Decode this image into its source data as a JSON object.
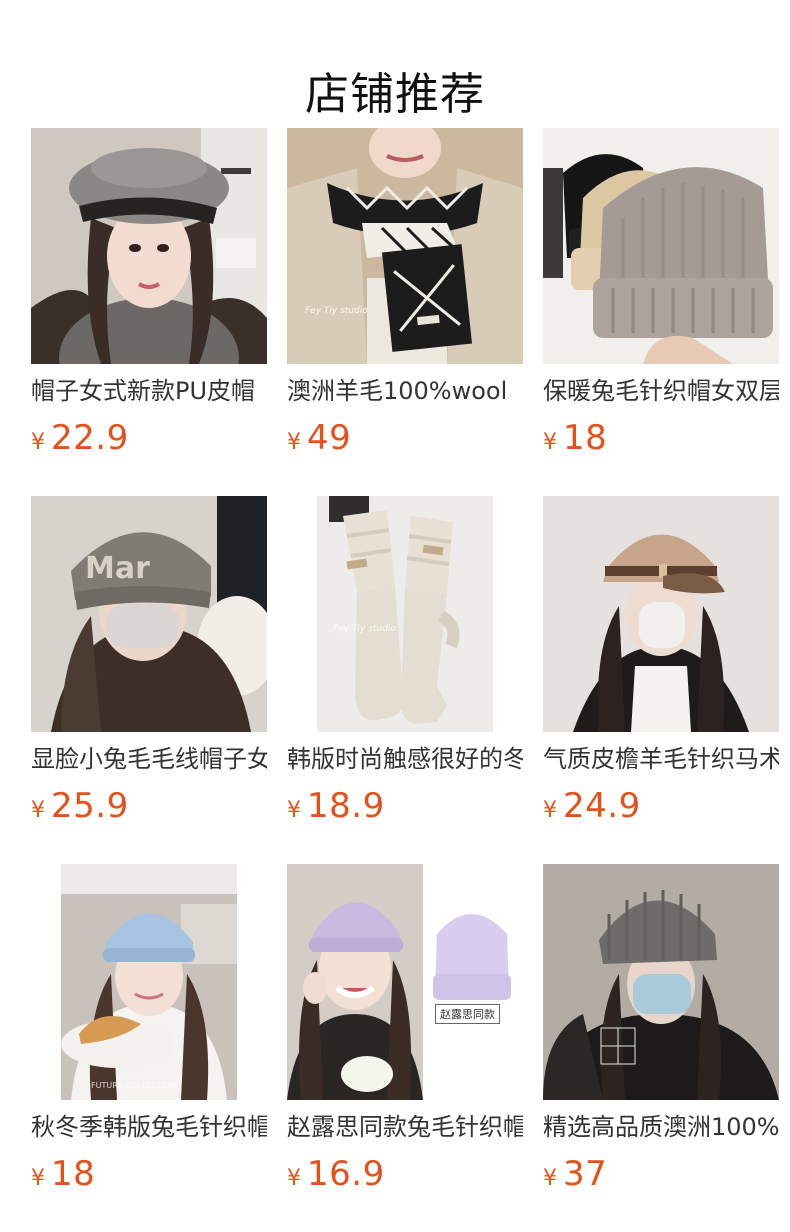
{
  "section": {
    "title": "店铺推荐"
  },
  "currency_symbol": "¥",
  "products": [
    {
      "title": "帽子女式新款PU皮帽",
      "price": "22.9",
      "image": "woman-grey-beret-photo"
    },
    {
      "title": "澳洲羊毛100%wool",
      "price": "49",
      "image": "black-white-argyle-scarf-photo"
    },
    {
      "title": "保暖兔毛针织帽女双层",
      "price": "18",
      "image": "stacked-knit-beanies-photo"
    },
    {
      "title": "显脸小兔毛毛线帽子女",
      "price": "25.9",
      "image": "woman-grey-letter-beanie-mask-photo"
    },
    {
      "title": "韩版时尚触感很好的冬",
      "price": "18.9",
      "image": "cream-knit-gloves-photo"
    },
    {
      "title": "气质皮檐羊毛针织马术",
      "price": "24.9",
      "image": "woman-tan-equestrian-hat-photo"
    },
    {
      "title": "秋冬季韩版兔毛针织帽",
      "price": "18",
      "image": "woman-light-blue-beanie-croissant-photo"
    },
    {
      "title": "赵露思同款兔毛针织帽",
      "price": "16.9",
      "image": "woman-lilac-beanie-photo",
      "tag": "赵露思同款"
    },
    {
      "title": "精选高品质澳洲100%羊",
      "price": "37",
      "image": "woman-grey-beanie-mask-photo"
    }
  ],
  "watermark": "Fey Tiy studio"
}
